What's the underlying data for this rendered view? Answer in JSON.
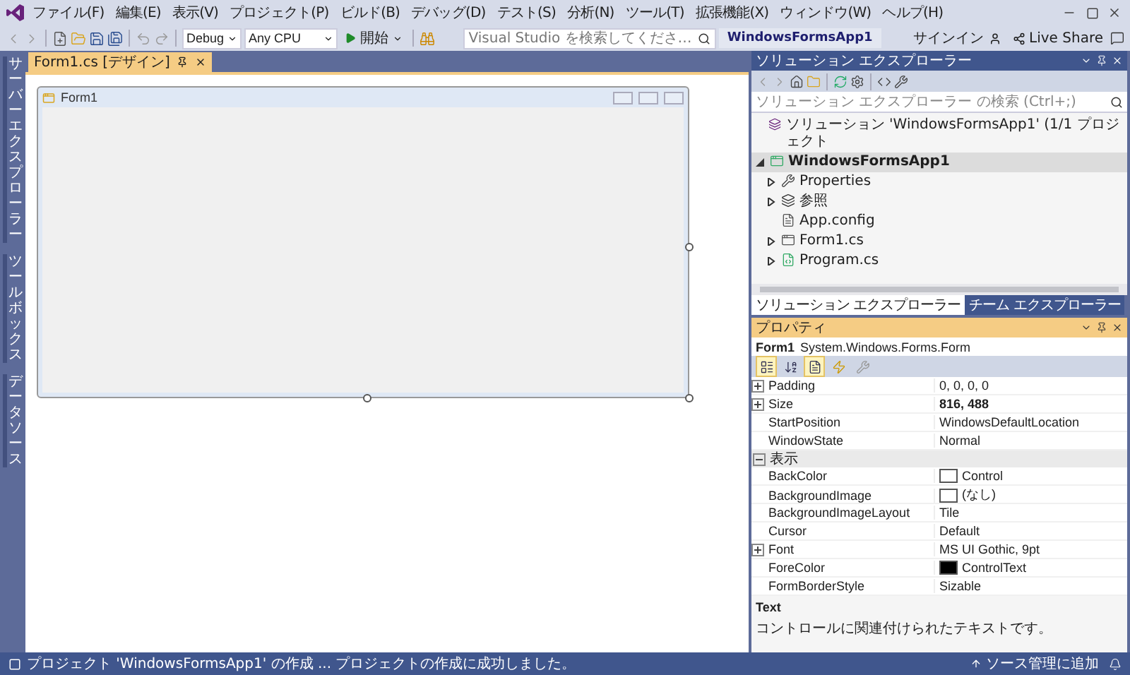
{
  "title_bar": {
    "menu": [
      "ファイル(F)",
      "編集(E)",
      "表示(V)",
      "プロジェクト(P)",
      "ビルド(B)",
      "デバッグ(D)",
      "テスト(S)",
      "分析(N)",
      "ツール(T)",
      "拡張機能(X)",
      "ウィンドウ(W)",
      "ヘルプ(H)"
    ],
    "search": {
      "placeholder": "Visual Studio を検索してくださ…"
    },
    "solution_name": "WindowsFormsApp1",
    "sign_in": "サインイン"
  },
  "toolbar": {
    "configuration": "Debug",
    "platform": "Any CPU",
    "start": "開始",
    "live_share": "Live Share"
  },
  "side_tabs": [
    "サーバーエクスプローラー",
    "ツールボックス",
    "データソース"
  ],
  "document_tabs": [
    {
      "label": "Form1.cs [デザイン]",
      "selected": true
    }
  ],
  "designer": {
    "form_title": "Form1"
  },
  "solution_explorer": {
    "title": "ソリューション エクスプローラー",
    "search": {
      "placeholder": "ソリューション エクスプローラー の検索 (Ctrl+;)"
    },
    "tree": [
      {
        "label": "ソリューション 'WindowsFormsApp1' (1/1 プロジェクト",
        "kind": "solution",
        "selected": false,
        "children": [
          {
            "label": "WindowsFormsApp1",
            "kind": "project",
            "selected": true,
            "expanded": true,
            "children": [
              {
                "label": "Properties",
                "kind": "properties",
                "selected": false,
                "expanded": false
              },
              {
                "label": "参照",
                "kind": "references",
                "selected": false,
                "expanded": false
              },
              {
                "label": "App.config",
                "kind": "config",
                "selected": false
              },
              {
                "label": "Form1.cs",
                "kind": "form",
                "selected": false,
                "expanded": false
              },
              {
                "label": "Program.cs",
                "kind": "code",
                "selected": false,
                "expanded": false
              }
            ]
          }
        ]
      }
    ],
    "tabs": [
      {
        "label": "ソリューション エクスプローラー",
        "selected": true
      },
      {
        "label": "チーム エクスプローラー",
        "selected": false
      }
    ]
  },
  "properties": {
    "title": "プロパティ",
    "object_name": "Form1",
    "object_type": "System.Windows.Forms.Form",
    "toolbar": [
      {
        "kind": "categorized",
        "selected": true
      },
      {
        "kind": "alphabetical",
        "selected": false
      },
      {
        "kind": "properties",
        "selected": true
      },
      {
        "kind": "events",
        "selected": false
      },
      {
        "kind": "pages",
        "selected": false
      }
    ],
    "rows": [
      {
        "kind": "property",
        "name": "Padding",
        "value": "0, 0, 0, 0",
        "expandable": true,
        "modified": false
      },
      {
        "kind": "property",
        "name": "Size",
        "value": "816, 488",
        "expandable": true,
        "modified": true
      },
      {
        "kind": "property",
        "name": "StartPosition",
        "value": "WindowsDefaultLocation",
        "expandable": false,
        "modified": false
      },
      {
        "kind": "property",
        "name": "WindowState",
        "value": "Normal",
        "expandable": false,
        "modified": false
      },
      {
        "kind": "category",
        "name": "表示",
        "expanded": true
      },
      {
        "kind": "property",
        "name": "BackColor",
        "value": "Control",
        "color": "#ffffff",
        "expandable": false,
        "modified": false
      },
      {
        "kind": "property",
        "name": "BackgroundImage",
        "value": "(なし)",
        "color": "#ffffff",
        "expandable": false,
        "modified": false
      },
      {
        "kind": "property",
        "name": "BackgroundImageLayout",
        "value": "Tile",
        "expandable": false,
        "modified": false
      },
      {
        "kind": "property",
        "name": "Cursor",
        "value": "Default",
        "expandable": false,
        "modified": false
      },
      {
        "kind": "property",
        "name": "Font",
        "value": "MS UI Gothic, 9pt",
        "expandable": true,
        "modified": false
      },
      {
        "kind": "property",
        "name": "ForeColor",
        "value": "ControlText",
        "color": "#000000",
        "expandable": false,
        "modified": false
      },
      {
        "kind": "property",
        "name": "FormBorderStyle",
        "value": "Sizable",
        "expandable": false,
        "modified": false
      }
    ],
    "description": {
      "title": "Text",
      "text": "コントロールに関連付けられたテキストです。"
    }
  },
  "status_bar": {
    "message": "プロジェクト 'WindowsFormsApp1' の作成 ... プロジェクトの作成に成功しました。",
    "source_control": "ソース管理に追加"
  }
}
